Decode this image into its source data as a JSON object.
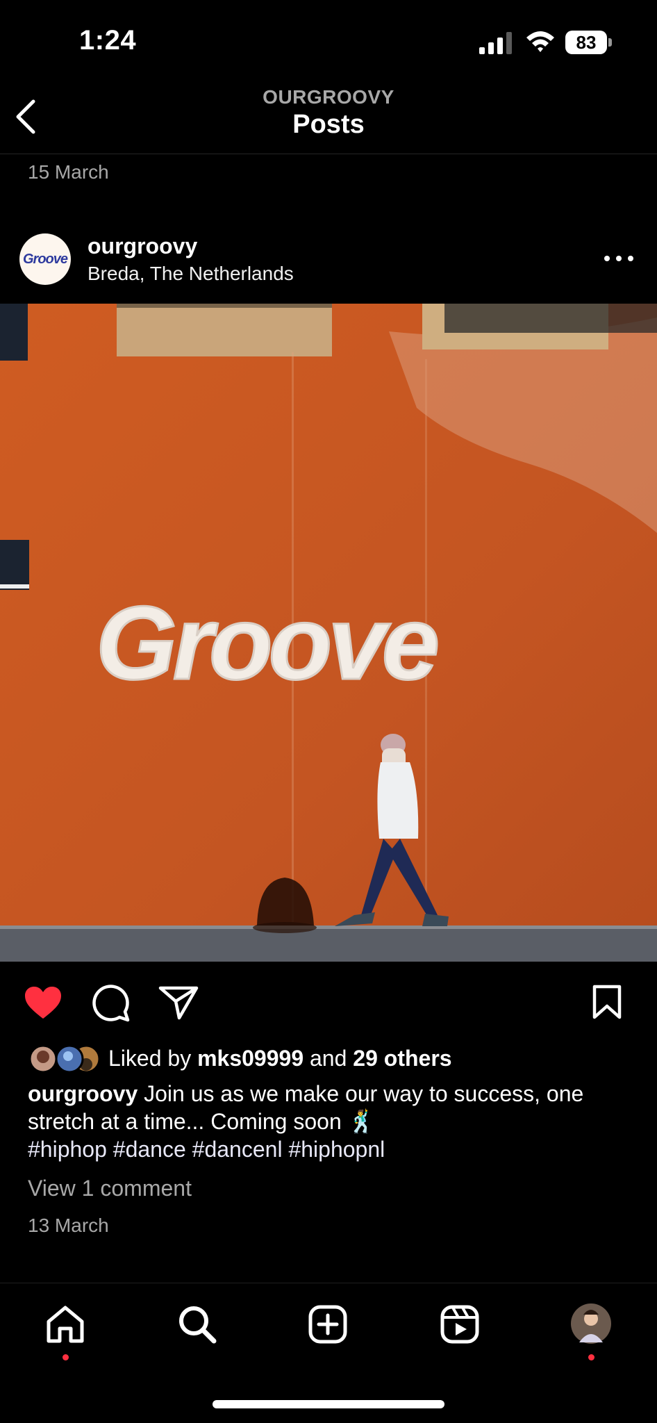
{
  "status_bar": {
    "time": "1:24",
    "battery": "83"
  },
  "header": {
    "subtitle": "OURGROOVY",
    "title": "Posts"
  },
  "feed": {
    "previous_date": "15 March"
  },
  "post": {
    "username": "ourgroovy",
    "location": "Breda, The Netherlands",
    "avatar_logo": "Groove",
    "image_text": "Groove",
    "liked": true,
    "likes": {
      "prefix": "Liked by",
      "user": "mks09999",
      "middle": "and",
      "others": "29 others"
    },
    "caption_user": "ourgroovy",
    "caption_text": "Join us as we make our way to success, one stretch at a time... Coming soon 🕺",
    "hashtags": "#hiphop #dance #dancenl #hiphopnl",
    "view_comments": "View 1 comment",
    "date": "13 March"
  },
  "tab_bar": {
    "items": [
      "home-icon",
      "search-icon",
      "create-icon",
      "reels-icon",
      "profile-avatar"
    ],
    "notification_color": "#ff3040"
  },
  "colors": {
    "like": "#ff3040",
    "wall": "#c95a23",
    "background": "#000000"
  }
}
